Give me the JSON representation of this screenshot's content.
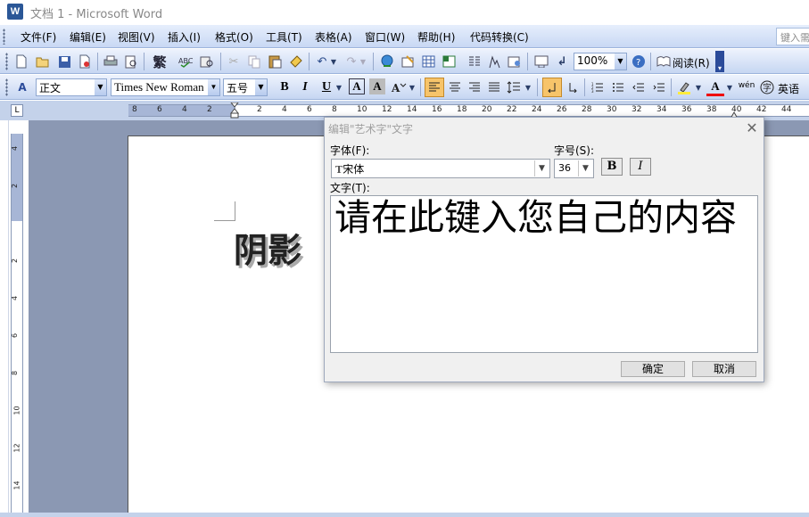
{
  "window": {
    "title": "文档 1 - Microsoft Word",
    "app_icon": "W"
  },
  "menubar": {
    "items": [
      "文件(F)",
      "编辑(E)",
      "视图(V)",
      "插入(I)",
      "格式(O)",
      "工具(T)",
      "表格(A)",
      "窗口(W)",
      "帮助(H)",
      "代码转换(C)"
    ],
    "help_box_text": "键入需"
  },
  "toolbar1": {
    "zoom": "100%",
    "read_label": "阅读(R)",
    "icons": [
      "new-icon",
      "open-icon",
      "save-icon",
      "permission-icon",
      "print-icon",
      "print-preview-icon",
      "traditional-chinese-icon",
      "spelling-icon",
      "research-icon",
      "cut-icon",
      "copy-icon",
      "paste-icon",
      "format-painter-icon",
      "undo-icon",
      "redo-icon",
      "hyperlink-icon",
      "tables-borders-icon",
      "insert-table-icon",
      "insert-excel-icon",
      "columns-icon",
      "drawing-icon",
      "document-map-icon",
      "show-hide-icon",
      "help-icon",
      "read-icon"
    ]
  },
  "toolbar2": {
    "style": "正文",
    "font": "Times New Roman",
    "size": "五号",
    "bold": "B",
    "italic": "I",
    "underline": "U",
    "char_border": "A",
    "char_shading": "A",
    "font_color_label": "A",
    "phonetic_label": "wén",
    "language": "英语"
  },
  "ruler": {
    "tab_selector": "L",
    "h_numbers": [
      "8",
      "6",
      "4",
      "2",
      "2",
      "4",
      "6",
      "8",
      "10",
      "12",
      "14",
      "16",
      "18",
      "20",
      "22",
      "24",
      "26",
      "28",
      "30",
      "32",
      "34",
      "36",
      "38",
      "40",
      "42",
      "44"
    ],
    "v_numbers": [
      "4",
      "2",
      "2",
      "4",
      "6",
      "8",
      "10",
      "12",
      "14"
    ]
  },
  "document": {
    "text": "阴影"
  },
  "dialog": {
    "title": "编辑\"艺术字\"文字",
    "font_label": "字体(F):",
    "font_value": "宋体",
    "font_prefix": "T",
    "size_label": "字号(S):",
    "size_value": "36",
    "bold_label": "B",
    "italic_label": "I",
    "text_label": "文字(T):",
    "text_value": "请在此键入您自己的内容",
    "ok_label": "确定",
    "cancel_label": "取消"
  },
  "colors": {
    "menubar": "#c8d8f4",
    "doc_background": "#8b98b3",
    "align_left_active": "#f7c46a"
  }
}
